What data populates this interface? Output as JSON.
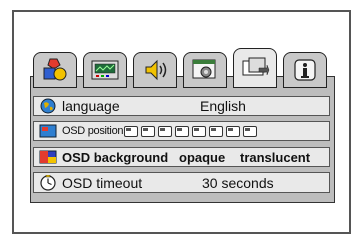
{
  "tabs": [
    {
      "icon": "shapes-icon"
    },
    {
      "icon": "monitor-icon"
    },
    {
      "icon": "speaker-icon"
    },
    {
      "icon": "settings-icon"
    },
    {
      "icon": "display-icon"
    },
    {
      "icon": "info-icon"
    }
  ],
  "rows": {
    "language": {
      "label": "language",
      "value": "English"
    },
    "osd_position": {
      "label": "OSD position",
      "position_options": 8
    },
    "osd_background": {
      "label": "OSD background",
      "options": [
        "opaque",
        "translucent"
      ]
    },
    "osd_timeout": {
      "label": "OSD timeout",
      "value": "30 seconds"
    }
  },
  "colors": {
    "panel": "#bdbdbd",
    "row": "#e9e9e9",
    "frame": "#555555"
  }
}
